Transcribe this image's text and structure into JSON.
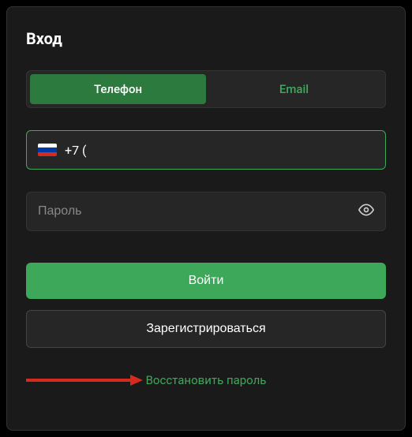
{
  "title": "Вход",
  "tabs": {
    "phone": "Телефон",
    "email": "Email"
  },
  "phone": {
    "prefix": "+7 ("
  },
  "password": {
    "placeholder": "Пароль"
  },
  "buttons": {
    "login": "Войти",
    "register": "Зарегистрироваться"
  },
  "links": {
    "restore": "Восстановить пароль"
  },
  "colors": {
    "accent": "#3ea85a",
    "arrow": "#d52b1e"
  }
}
